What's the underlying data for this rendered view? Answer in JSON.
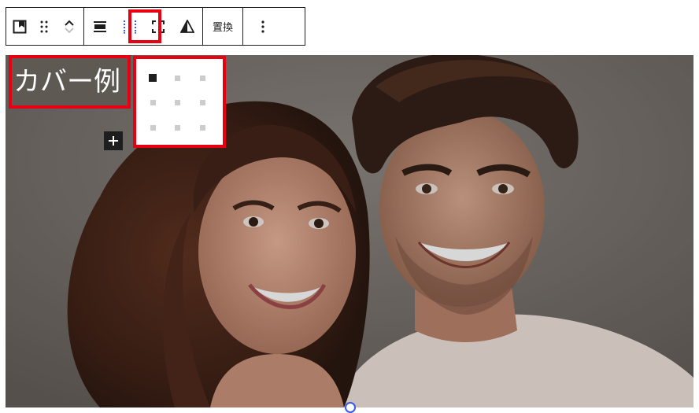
{
  "toolbar": {
    "replace_label": "置換",
    "buttons": [
      {
        "name": "cover-block-type-button"
      },
      {
        "name": "drag-handle"
      },
      {
        "name": "move-up-button"
      },
      {
        "name": "move-down-button"
      },
      {
        "name": "align-button"
      },
      {
        "name": "content-position-button",
        "highlighted": true
      },
      {
        "name": "full-height-button"
      },
      {
        "name": "duotone-button"
      },
      {
        "name": "replace-button"
      },
      {
        "name": "options-button"
      }
    ]
  },
  "cover": {
    "title": "カバー例",
    "add_block_label": "+"
  },
  "position_matrix": {
    "rows": 3,
    "cols": 3,
    "selected": "top-left"
  },
  "colors": {
    "highlight": "#e60012",
    "toolbar_active_dots": "#3858e9",
    "dark": "#1e1e1e"
  }
}
